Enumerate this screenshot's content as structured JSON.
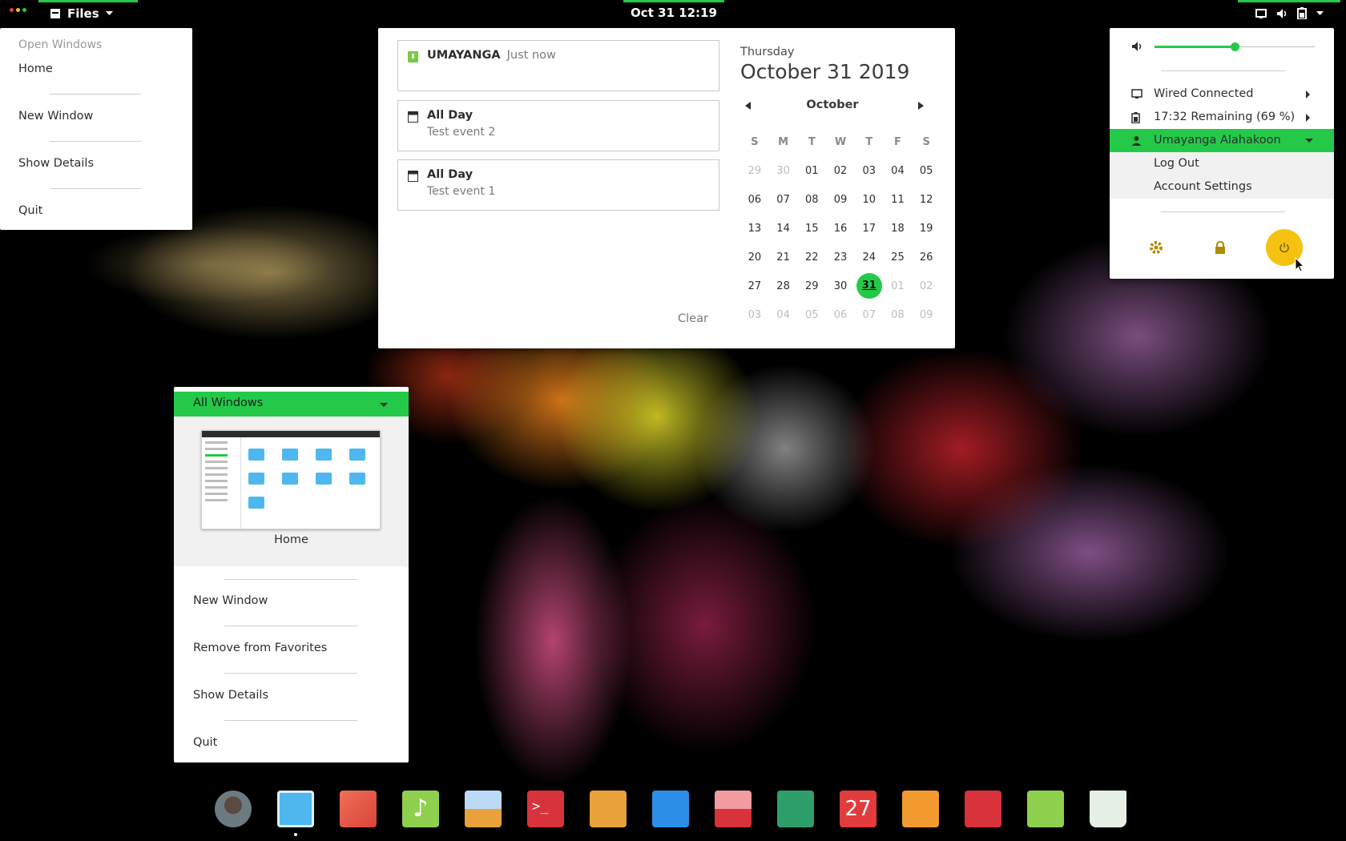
{
  "topbar": {
    "app_menu_label": "Files",
    "clock": "Oct 31  12:19",
    "accent": "#24c949"
  },
  "app_menu": {
    "header": "Open Windows",
    "items": [
      "Home",
      "New Window",
      "Show Details",
      "Quit"
    ]
  },
  "calendar_popup": {
    "notifications": [
      {
        "title": "UMAYANGA",
        "time": "Just now",
        "subtitle": "",
        "icon": "app-badge-icon"
      },
      {
        "title": "All Day",
        "subtitle": "Test event 2",
        "icon": "calendar-event-icon"
      },
      {
        "title": "All Day",
        "subtitle": "Test event 1",
        "icon": "calendar-event-icon"
      }
    ],
    "clear_label": "Clear",
    "weekday": "Thursday",
    "date_long": "October 31 2019",
    "month": "October",
    "weekdays": [
      "S",
      "M",
      "T",
      "W",
      "T",
      "F",
      "S"
    ],
    "weeks": [
      [
        "29",
        "30",
        "01",
        "02",
        "03",
        "04",
        "05"
      ],
      [
        "06",
        "07",
        "08",
        "09",
        "10",
        "11",
        "12"
      ],
      [
        "13",
        "14",
        "15",
        "16",
        "17",
        "18",
        "19"
      ],
      [
        "20",
        "21",
        "22",
        "23",
        "24",
        "25",
        "26"
      ],
      [
        "27",
        "28",
        "29",
        "30",
        "31",
        "01",
        "02"
      ],
      [
        "03",
        "04",
        "05",
        "06",
        "07",
        "08",
        "09"
      ]
    ],
    "today": "31"
  },
  "system_menu": {
    "volume_level": 0.5,
    "network": "Wired Connected",
    "battery": "17:32 Remaining (69 %)",
    "user": "Umayanga Alahakoon",
    "user_items": [
      "Log Out",
      "Account Settings"
    ],
    "buttons": [
      "settings-icon",
      "lock-icon",
      "power-icon"
    ],
    "power_color": "#f5c211"
  },
  "dash_menu": {
    "selector": "All Windows",
    "preview_label": "Home",
    "items": [
      "New Window",
      "Remove from Favorites",
      "Show Details",
      "Quit"
    ]
  },
  "dock": {
    "apps": [
      "avatar-app",
      "files",
      "screen-recorder",
      "music",
      "image-viewer",
      "terminal",
      "mixer",
      "video-player",
      "screenshot",
      "passwords",
      "calendar",
      "software-store",
      "settings-tweaks",
      "usb-writer",
      "trash"
    ],
    "calendar_day": "27"
  }
}
